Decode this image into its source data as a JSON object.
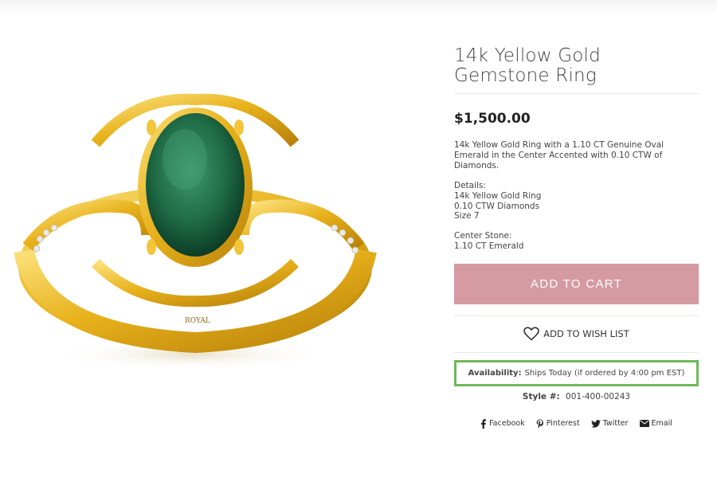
{
  "product": {
    "title_line1": "14k Yellow Gold",
    "title_line2": "Gemstone Ring",
    "price": "$1,500.00",
    "description": "14k Yellow Gold Ring with a 1.10 CT Genuine Oval Emerald in the Center Accented with 0.10 CTW of Diamonds.",
    "details": {
      "heading": "Details:",
      "lines": [
        "14k Yellow Gold Ring",
        "0.10 CTW Diamonds",
        "Size 7"
      ]
    },
    "center_stone": {
      "heading": "Center Stone:",
      "lines": [
        "1.10 CT Emerald"
      ]
    },
    "ring_stamp": "ROYAL"
  },
  "actions": {
    "add_to_cart": "ADD TO CART",
    "add_to_wishlist": "ADD TO WISH LIST"
  },
  "availability": {
    "label": "Availability:",
    "value": "Ships Today (if ordered by 4:00 pm EST)"
  },
  "style": {
    "label": "Style #:",
    "value": "001-400-00243"
  },
  "share": [
    {
      "label": "Facebook",
      "icon": "facebook-icon"
    },
    {
      "label": "Pinterest",
      "icon": "pinterest-icon"
    },
    {
      "label": "Twitter",
      "icon": "twitter-icon"
    },
    {
      "label": "Email",
      "icon": "email-icon"
    }
  ],
  "colors": {
    "add_to_cart_bg": "#d69aa3",
    "availability_border": "#6db85b",
    "gold": "#e8b21c",
    "emerald": "#1f6b46"
  }
}
